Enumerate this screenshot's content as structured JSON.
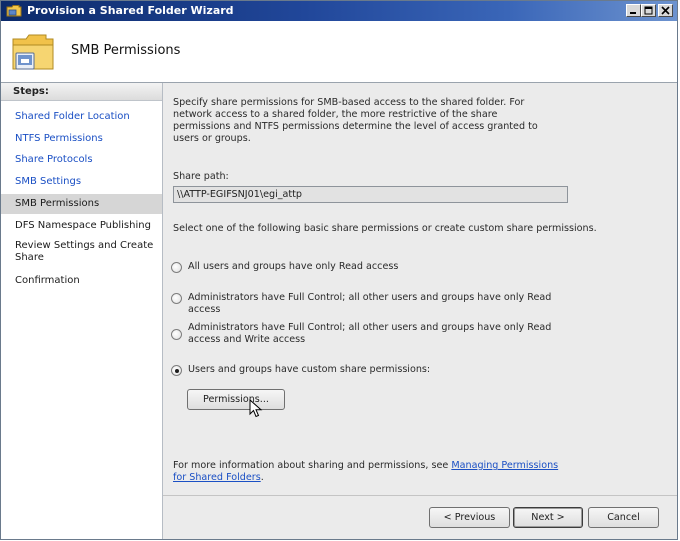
{
  "window": {
    "title": "Provision a Shared Folder Wizard"
  },
  "header": {
    "title": "SMB Permissions"
  },
  "steps": {
    "heading": "Steps:",
    "items": [
      {
        "label": "Shared Folder Location"
      },
      {
        "label": "NTFS Permissions"
      },
      {
        "label": "Share Protocols"
      },
      {
        "label": "SMB Settings"
      },
      {
        "label": "SMB Permissions"
      },
      {
        "label": "DFS Namespace Publishing"
      },
      {
        "label": "Review Settings and Create Share"
      },
      {
        "label": "Confirmation"
      }
    ]
  },
  "content": {
    "intro": "Specify share permissions for SMB-based access to the shared folder. For network access to a shared folder, the more restrictive of the share permissions and NTFS permissions determine the level of access granted to users or groups.",
    "share_path_label": "Share path:",
    "share_path_value": "\\\\ATTP-EGIFSNJ01\\egi_attp",
    "select_text": "Select one of the following basic share permissions or create custom share permissions.",
    "options": [
      {
        "label": "All users and groups have only Read access",
        "checked": false
      },
      {
        "label": "Administrators have Full Control; all other users and groups have only Read access",
        "checked": false
      },
      {
        "label": "Administrators have Full Control; all other users and groups have only Read access and Write access",
        "checked": false
      },
      {
        "label": "Users and groups have custom share permissions:",
        "checked": true
      }
    ],
    "permissions_button": "Permissions...",
    "footer_text": "For more information about sharing and permissions, see ",
    "footer_link": "Managing Permissions for Shared Folders",
    "footer_end": "."
  },
  "buttons": {
    "previous": "< Previous",
    "next": "Next >",
    "cancel": "Cancel"
  },
  "colors": {
    "link": "#1a4fc4",
    "title_bar": "#21479a",
    "selected_step": "#d6d6d6"
  },
  "icons": {
    "title": "folder-wizard-icon",
    "header": "shared-folder-icon"
  }
}
